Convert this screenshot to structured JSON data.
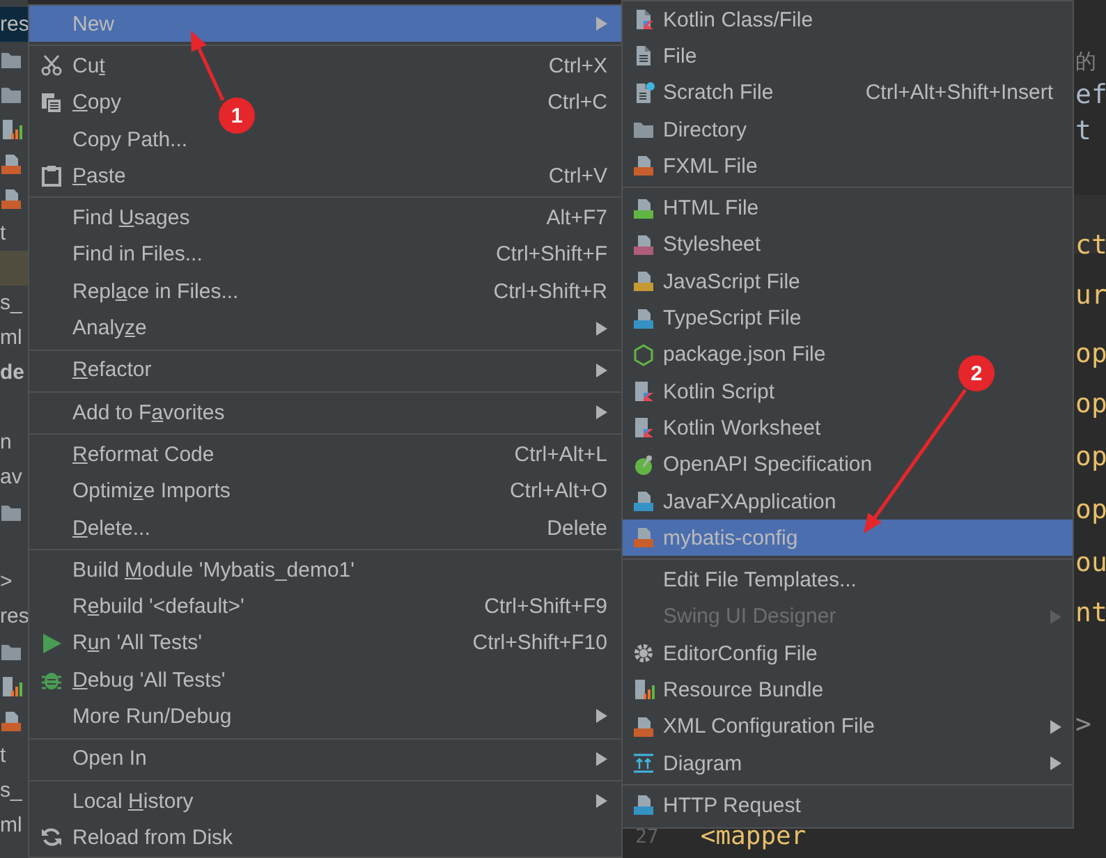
{
  "project_tree": [
    {
      "kind": "header",
      "text": "res"
    },
    {
      "kind": "folder"
    },
    {
      "kind": "folder"
    },
    {
      "kind": "bundle"
    },
    {
      "kind": "xml"
    },
    {
      "kind": "xml"
    },
    {
      "kind": "text",
      "text": "t"
    },
    {
      "kind": "highlight"
    },
    {
      "kind": "text",
      "text": "s_"
    },
    {
      "kind": "text",
      "text": "ml"
    },
    {
      "kind": "bold",
      "text": "de"
    },
    {
      "kind": "blank"
    },
    {
      "kind": "text",
      "text": "n"
    },
    {
      "kind": "text",
      "text": "av"
    },
    {
      "kind": "folder"
    },
    {
      "kind": "blank"
    },
    {
      "kind": "text",
      "text": ">"
    },
    {
      "kind": "text",
      "text": "res"
    },
    {
      "kind": "folder"
    },
    {
      "kind": "bundle"
    },
    {
      "kind": "xml"
    },
    {
      "kind": "text",
      "text": "t"
    },
    {
      "kind": "text",
      "text": "s_"
    },
    {
      "kind": "text",
      "text": "ml"
    }
  ],
  "editor": {
    "lines": [
      {
        "kind": "comment",
        "text": "的"
      },
      {
        "kind": "plain",
        "text": "ef"
      },
      {
        "kind": "plain",
        "text": "t"
      },
      {
        "kind": "tag",
        "text": "ct"
      },
      {
        "kind": "tag",
        "text": "ur"
      },
      {
        "kind": "tag",
        "text": "op"
      },
      {
        "kind": "tag",
        "text": "op"
      },
      {
        "kind": "tag",
        "text": "op"
      },
      {
        "kind": "tag",
        "text": "op"
      },
      {
        "kind": "tag",
        "text": "ou"
      },
      {
        "kind": "tag",
        "text": "nt"
      },
      {
        "kind": "plain",
        "text": ">"
      }
    ],
    "bottom_line": {
      "line_number": "27",
      "text": "<mapper"
    }
  },
  "main_menu": {
    "items": [
      {
        "kind": "item",
        "label": "New",
        "submenu": true,
        "selected": true
      },
      {
        "kind": "separator"
      },
      {
        "kind": "item",
        "label": "Cut",
        "shortcut": "Ctrl+X",
        "submenu": false,
        "selected": false
      },
      {
        "kind": "item",
        "label": "Copy",
        "shortcut": "Ctrl+C",
        "submenu": false,
        "selected": false
      },
      {
        "kind": "item",
        "label": "Copy Path...",
        "submenu": false,
        "selected": false
      },
      {
        "kind": "item",
        "label": "Paste",
        "shortcut": "Ctrl+V",
        "submenu": false,
        "selected": false
      },
      {
        "kind": "separator"
      },
      {
        "kind": "item",
        "label": "Find Usages",
        "shortcut": "Alt+F7",
        "submenu": false,
        "selected": false
      },
      {
        "kind": "item",
        "label": "Find in Files...",
        "shortcut": "Ctrl+Shift+F",
        "submenu": false,
        "selected": false
      },
      {
        "kind": "item",
        "label": "Replace in Files...",
        "shortcut": "Ctrl+Shift+R",
        "submenu": false,
        "selected": false
      },
      {
        "kind": "item",
        "label": "Analyze",
        "submenu": true,
        "selected": false
      },
      {
        "kind": "separator"
      },
      {
        "kind": "item",
        "label": "Refactor",
        "submenu": true,
        "selected": false
      },
      {
        "kind": "separator"
      },
      {
        "kind": "item",
        "label": "Add to Favorites",
        "submenu": true,
        "selected": false
      },
      {
        "kind": "separator"
      },
      {
        "kind": "item",
        "label": "Reformat Code",
        "shortcut": "Ctrl+Alt+L",
        "submenu": false,
        "selected": false
      },
      {
        "kind": "item",
        "label": "Optimize Imports",
        "shortcut": "Ctrl+Alt+O",
        "submenu": false,
        "selected": false
      },
      {
        "kind": "item",
        "label": "Delete...",
        "shortcut": "Delete",
        "submenu": false,
        "selected": false
      },
      {
        "kind": "separator"
      },
      {
        "kind": "item",
        "label": "Build Module 'Mybatis_demo1'",
        "submenu": false,
        "selected": false
      },
      {
        "kind": "item",
        "label": "Rebuild '<default>'",
        "shortcut": "Ctrl+Shift+F9",
        "submenu": false,
        "selected": false
      },
      {
        "kind": "item",
        "label": "Run 'All Tests'",
        "shortcut": "Ctrl+Shift+F10",
        "submenu": false,
        "selected": false
      },
      {
        "kind": "item",
        "label": "Debug 'All Tests'",
        "submenu": false,
        "selected": false
      },
      {
        "kind": "item",
        "label": "More Run/Debug",
        "submenu": true,
        "selected": false
      },
      {
        "kind": "separator"
      },
      {
        "kind": "item",
        "label": "Open In",
        "submenu": true,
        "selected": false
      },
      {
        "kind": "separator"
      },
      {
        "kind": "item",
        "label": "Local History",
        "submenu": true,
        "selected": false
      },
      {
        "kind": "item",
        "label": "Reload from Disk",
        "submenu": false,
        "selected": false
      }
    ]
  },
  "new_submenu": {
    "items": [
      {
        "kind": "item",
        "label": "Kotlin Class/File",
        "submenu": false,
        "disabled": false,
        "selected": false
      },
      {
        "kind": "item",
        "label": "File",
        "submenu": false,
        "disabled": false,
        "selected": false
      },
      {
        "kind": "item",
        "label": "Scratch File",
        "shortcut": "Ctrl+Alt+Shift+Insert",
        "submenu": false,
        "disabled": false,
        "selected": false
      },
      {
        "kind": "item",
        "label": "Directory",
        "submenu": false,
        "disabled": false,
        "selected": false
      },
      {
        "kind": "item",
        "label": "FXML File",
        "submenu": false,
        "disabled": false,
        "selected": false
      },
      {
        "kind": "separator"
      },
      {
        "kind": "item",
        "label": "HTML File",
        "submenu": false,
        "disabled": false,
        "selected": false
      },
      {
        "kind": "item",
        "label": "Stylesheet",
        "submenu": false,
        "disabled": false,
        "selected": false
      },
      {
        "kind": "item",
        "label": "JavaScript File",
        "submenu": false,
        "disabled": false,
        "selected": false
      },
      {
        "kind": "item",
        "label": "TypeScript File",
        "submenu": false,
        "disabled": false,
        "selected": false
      },
      {
        "kind": "item",
        "label": "package.json File",
        "submenu": false,
        "disabled": false,
        "selected": false
      },
      {
        "kind": "item",
        "label": "Kotlin Script",
        "submenu": false,
        "disabled": false,
        "selected": false
      },
      {
        "kind": "item",
        "label": "Kotlin Worksheet",
        "submenu": false,
        "disabled": false,
        "selected": false
      },
      {
        "kind": "item",
        "label": "OpenAPI Specification",
        "submenu": false,
        "disabled": false,
        "selected": false
      },
      {
        "kind": "item",
        "label": "JavaFXApplication",
        "submenu": false,
        "disabled": false,
        "selected": false
      },
      {
        "kind": "item",
        "label": "mybatis-config",
        "submenu": false,
        "disabled": false,
        "selected": true
      },
      {
        "kind": "separator"
      },
      {
        "kind": "item",
        "label": "Edit File Templates...",
        "submenu": false,
        "disabled": false,
        "selected": false
      },
      {
        "kind": "item",
        "label": "Swing UI Designer",
        "submenu": true,
        "disabled": true,
        "selected": false
      },
      {
        "kind": "item",
        "label": "EditorConfig File",
        "submenu": false,
        "disabled": false,
        "selected": false
      },
      {
        "kind": "item",
        "label": "Resource Bundle",
        "submenu": false,
        "disabled": false,
        "selected": false
      },
      {
        "kind": "item",
        "label": "XML Configuration File",
        "submenu": true,
        "disabled": false,
        "selected": false
      },
      {
        "kind": "item",
        "label": "Diagram",
        "submenu": true,
        "disabled": false,
        "selected": false
      },
      {
        "kind": "separator"
      },
      {
        "kind": "item",
        "label": "HTTP Request",
        "submenu": false,
        "disabled": false,
        "selected": false
      }
    ]
  },
  "annotations": [
    {
      "label": "1"
    },
    {
      "label": "2"
    }
  ]
}
